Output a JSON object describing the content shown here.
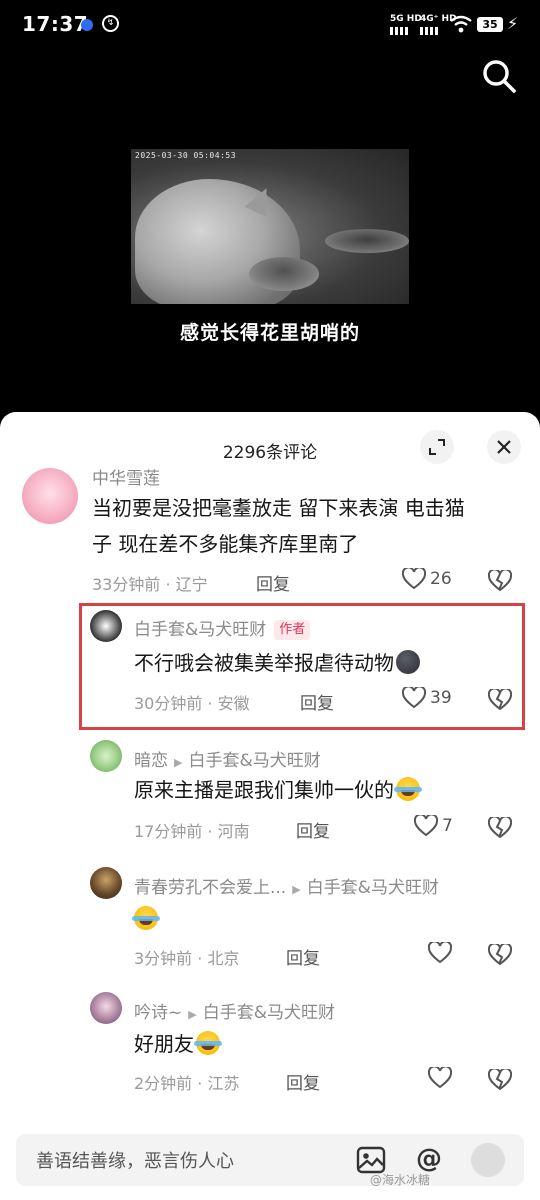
{
  "status_bar": {
    "time": "17:37",
    "net1": "5G HD",
    "net2": "4G⁺ HD",
    "battery": "35"
  },
  "video": {
    "timestamp": "2025-03-30  05:04:53",
    "caption": "感觉长得花里胡哨的"
  },
  "sheet": {
    "title": "2296条评论"
  },
  "comments": [
    {
      "author": "中华雪莲",
      "text_line1": "当初要是没把毫耋放走 留下来表演 电击猫",
      "text_line2": "子 现在差不多能集齐库里南了",
      "time_loc": "33分钟前 · 辽宁",
      "reply": "回复",
      "likes": "26"
    },
    {
      "author": "白手套&马犬旺财",
      "badge": "作者",
      "text": "不行哦会被集美举报虐待动物",
      "time_loc": "30分钟前 · 安徽",
      "reply": "回复",
      "likes": "39"
    },
    {
      "author": "暗恋",
      "reply_to": "白手套&马犬旺财",
      "text": "原来主播是跟我们集帅一伙的",
      "time_loc": "17分钟前 · 河南",
      "reply": "回复",
      "likes": "7"
    },
    {
      "author": "青春劳孔不会爱上...",
      "reply_to": "白手套&马犬旺财",
      "time_loc": "3分钟前 · 北京",
      "reply": "回复"
    },
    {
      "author": "吟诗~",
      "reply_to": "白手套&马犬旺财",
      "text": "好朋友",
      "time_loc": "2分钟前 · 江苏",
      "reply": "回复"
    }
  ],
  "input": {
    "placeholder": "善语结善缘，恶言伤人心"
  },
  "watermark": "@海水冰糖"
}
